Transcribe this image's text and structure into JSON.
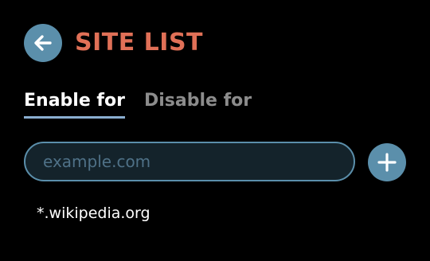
{
  "header": {
    "title": "SITE LIST",
    "back_icon": "arrow-left-icon"
  },
  "tabs": [
    {
      "label": "Enable for",
      "active": true
    },
    {
      "label": "Disable for",
      "active": false
    }
  ],
  "add_site": {
    "placeholder": "example.com",
    "value": "",
    "add_icon": "plus-icon"
  },
  "sites": [
    {
      "pattern": "*.wikipedia.org"
    }
  ],
  "colors": {
    "background": "#000000",
    "accent": "#5b8fab",
    "title": "#e07057",
    "tab_underline": "#8aaed0",
    "inactive_tab": "#8c8c8c"
  }
}
